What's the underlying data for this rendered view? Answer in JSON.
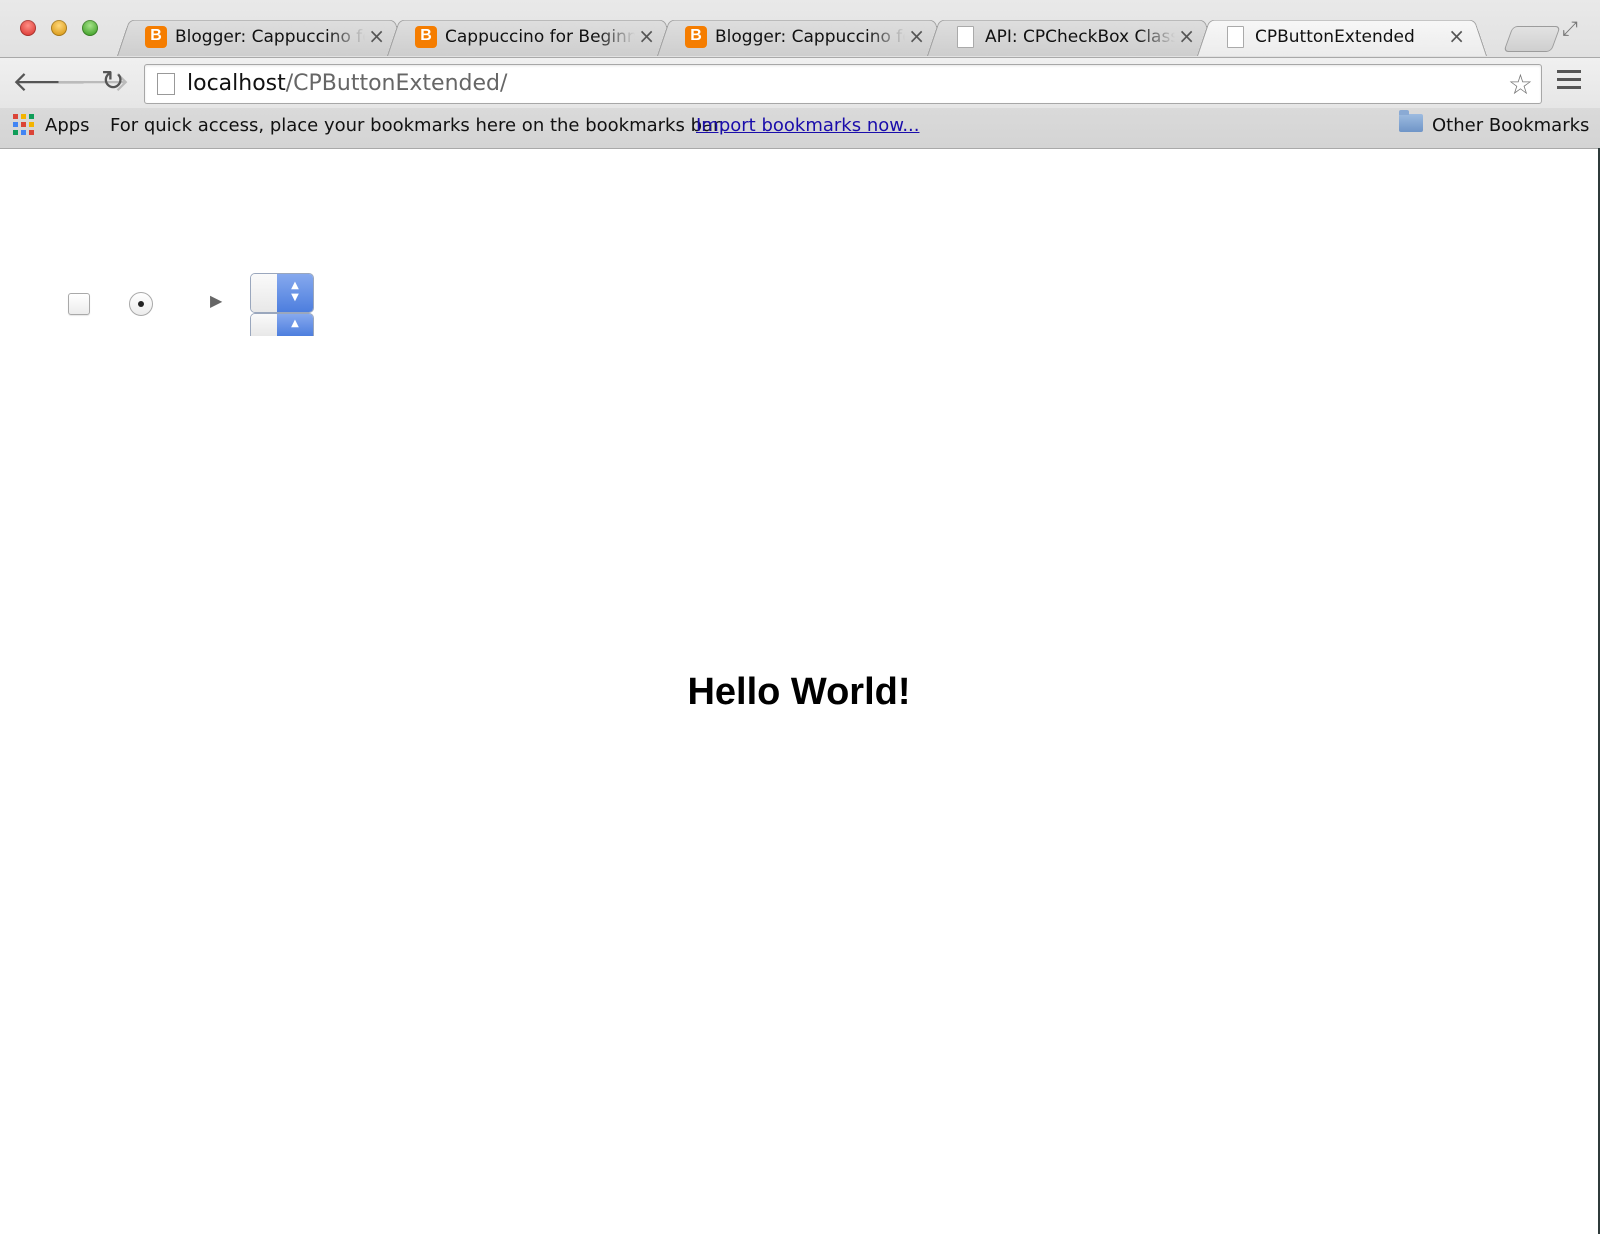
{
  "window": {
    "tabs": [
      {
        "title": "Blogger: Cappuccino fo",
        "icon": "blogger-icon",
        "active": false
      },
      {
        "title": "Cappuccino for Beginne",
        "icon": "blogger-icon",
        "active": false
      },
      {
        "title": "Blogger: Cappuccino fo",
        "icon": "blogger-icon",
        "active": false
      },
      {
        "title": "API: CPCheckBox Class",
        "icon": "document-icon",
        "active": false
      },
      {
        "title": "CPButtonExtended",
        "icon": "document-icon",
        "active": true
      }
    ],
    "close_glyph": "×"
  },
  "toolbar": {
    "url_host": "localhost",
    "url_path": "/CPButtonExtended/"
  },
  "bookmarks_bar": {
    "apps_label": "Apps",
    "hint": "For quick access, place your bookmarks here on the bookmarks bar.",
    "import_link": "Import bookmarks now...",
    "other_label": "Other Bookmarks"
  },
  "content": {
    "heading": "Hello World!",
    "controls": {
      "checkbox_checked": false,
      "radio_selected": true,
      "disclosure_expanded": false
    }
  },
  "colors": {
    "link": "#1a0dab",
    "stepper_blue": "#4d7ede",
    "blogger_orange": "#f57d00"
  }
}
